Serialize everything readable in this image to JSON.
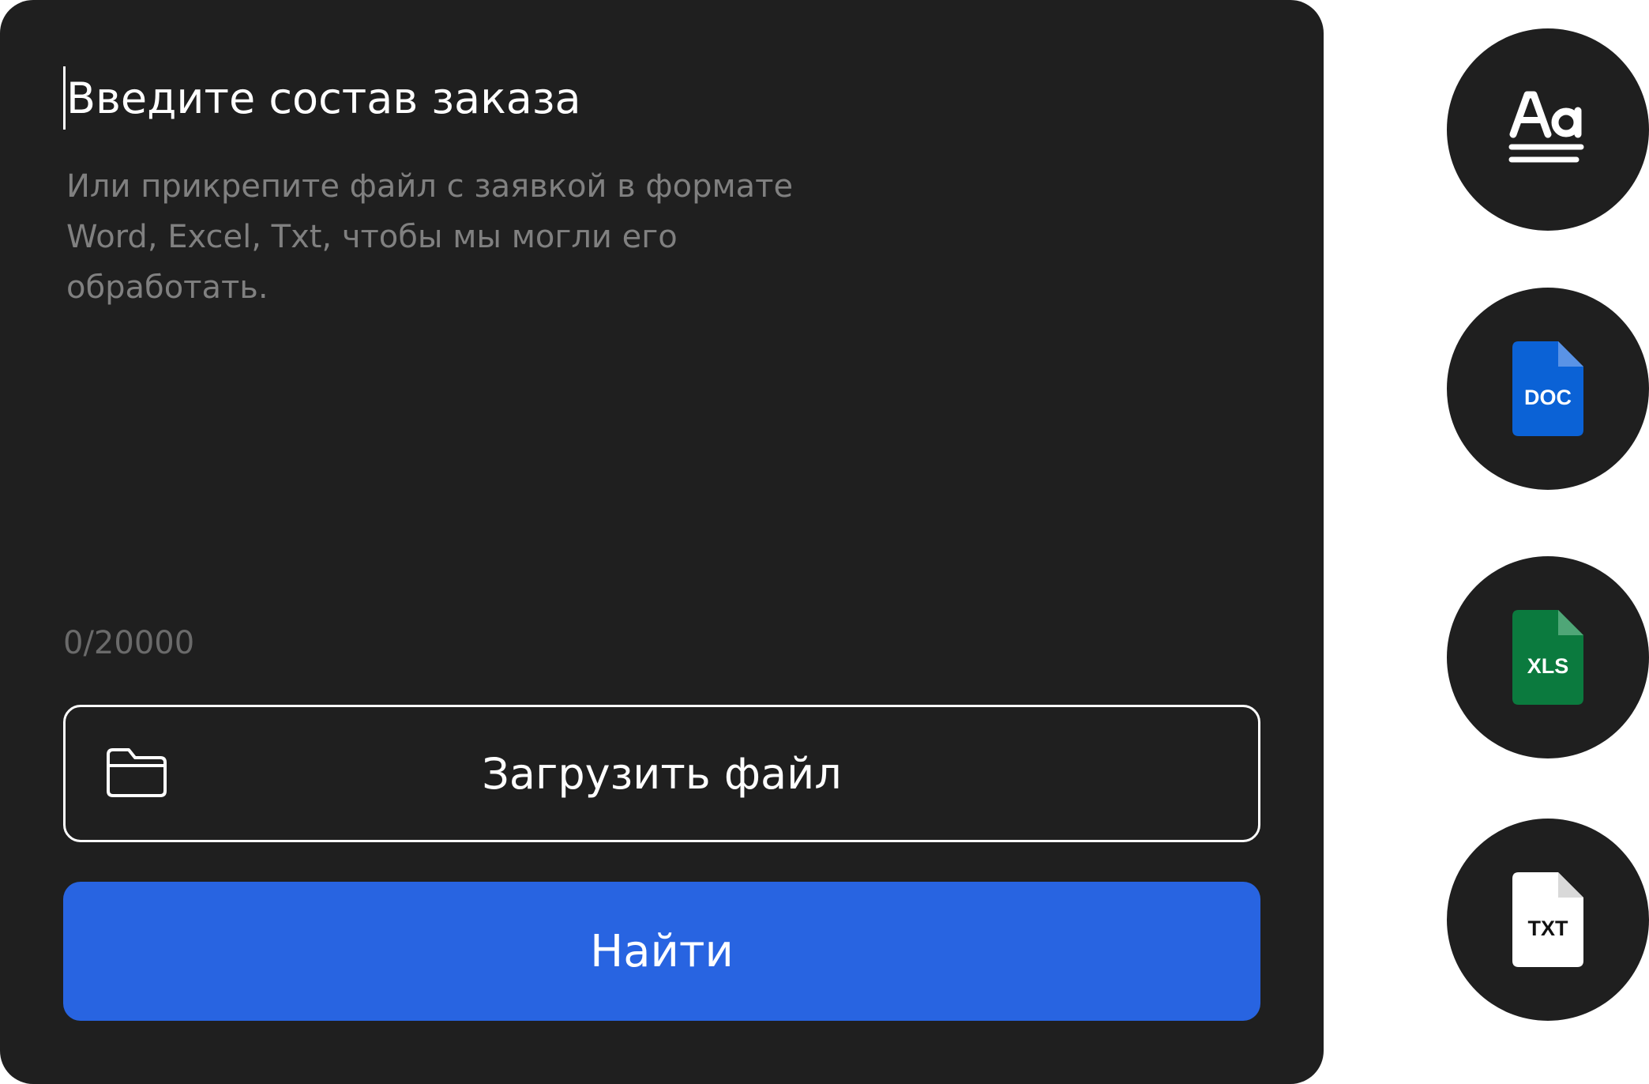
{
  "order_form": {
    "input_title": "Введите состав заказа",
    "input_hint": "Или прикрепите файл с заявкой в формате Word, Excel, Txt, чтобы мы могли его обработать.",
    "char_counter": "0/20000",
    "upload_button_label": "Загрузить файл",
    "find_button_label": "Найти"
  },
  "formats": [
    {
      "icon": "text-format-icon",
      "label": ""
    },
    {
      "icon": "doc-file-icon",
      "label": "DOC",
      "color": "#0b62d6"
    },
    {
      "icon": "xls-file-icon",
      "label": "XLS",
      "color": "#0b7a3e"
    },
    {
      "icon": "txt-file-icon",
      "label": "TXT",
      "color": "#ffffff"
    }
  ],
  "colors": {
    "panel_background": "#1f1f1f",
    "accent": "#2864e1",
    "hint_text": "#808080"
  }
}
